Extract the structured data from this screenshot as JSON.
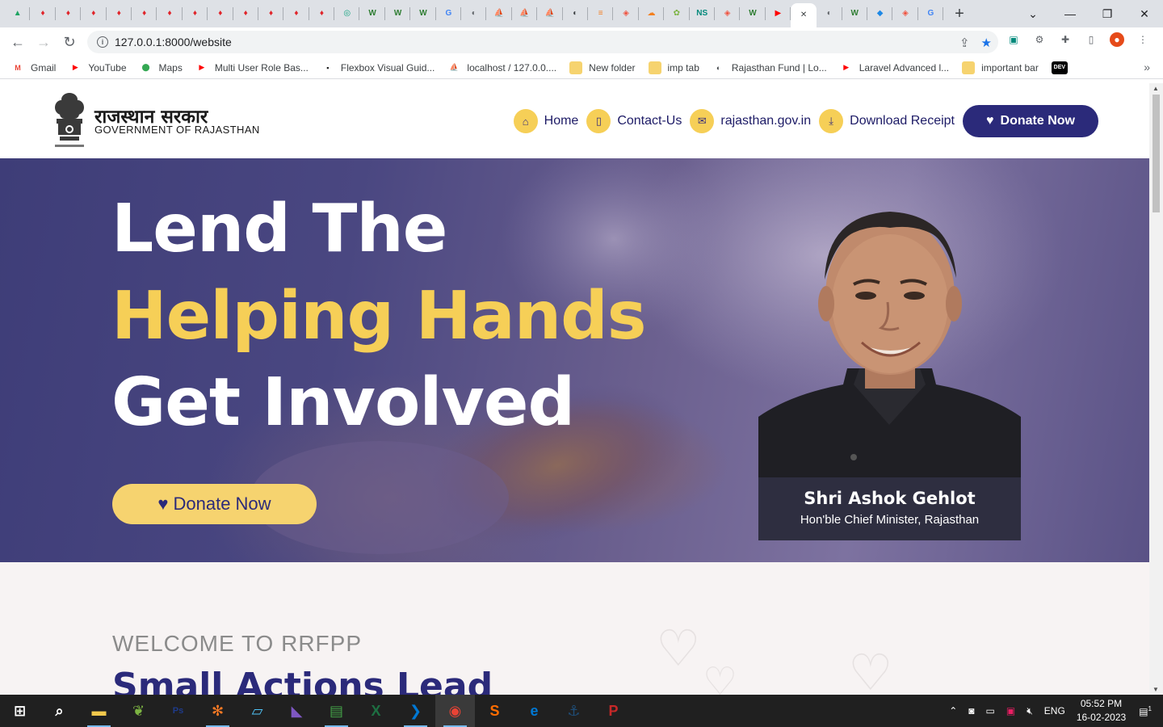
{
  "browser": {
    "tabs": [
      {
        "icon": "google-drive-icon",
        "glyph": "▲",
        "color": "#1fa463"
      },
      {
        "icon": "pin-icon",
        "glyph": "♦",
        "color": "#e0242a"
      },
      {
        "icon": "pin-icon",
        "glyph": "♦",
        "color": "#e0242a"
      },
      {
        "icon": "pin-icon",
        "glyph": "♦",
        "color": "#e0242a"
      },
      {
        "icon": "pin-icon",
        "glyph": "♦",
        "color": "#e0242a"
      },
      {
        "icon": "pin-icon",
        "glyph": "♦",
        "color": "#e0242a"
      },
      {
        "icon": "pin-icon",
        "glyph": "♦",
        "color": "#e0242a"
      },
      {
        "icon": "pin-icon",
        "glyph": "♦",
        "color": "#e0242a"
      },
      {
        "icon": "pin-icon",
        "glyph": "♦",
        "color": "#e0242a"
      },
      {
        "icon": "pin-icon",
        "glyph": "♦",
        "color": "#e0242a"
      },
      {
        "icon": "pin-icon",
        "glyph": "♦",
        "color": "#e0242a"
      },
      {
        "icon": "pin-icon",
        "glyph": "♦",
        "color": "#e0242a"
      },
      {
        "icon": "pin-icon",
        "glyph": "♦",
        "color": "#e0242a"
      },
      {
        "icon": "chatgpt-icon",
        "glyph": "◎",
        "color": "#10a37f"
      },
      {
        "icon": "w-icon",
        "glyph": "W",
        "color": "#2e7d32"
      },
      {
        "icon": "w-icon",
        "glyph": "W",
        "color": "#2e7d32"
      },
      {
        "icon": "w-icon",
        "glyph": "W",
        "color": "#2e7d32"
      },
      {
        "icon": "translate-icon",
        "glyph": "G",
        "color": "#4285f4"
      },
      {
        "icon": "globe-icon",
        "glyph": "◐",
        "color": "#5f6368"
      },
      {
        "icon": "phpmyadmin-icon",
        "glyph": "⛵",
        "color": "#e08c1a"
      },
      {
        "icon": "phpmyadmin-icon",
        "glyph": "⛵",
        "color": "#e08c1a"
      },
      {
        "icon": "phpmyadmin-icon",
        "glyph": "⛵",
        "color": "#e08c1a"
      },
      {
        "icon": "globe-icon",
        "glyph": "◐",
        "color": "#3c4043"
      },
      {
        "icon": "stackoverflow-icon",
        "glyph": "≡",
        "color": "#f48024"
      },
      {
        "icon": "laravel-icon",
        "glyph": "◈",
        "color": "#f05340"
      },
      {
        "icon": "cloud-icon",
        "glyph": "☁",
        "color": "#f38020"
      },
      {
        "icon": "app-icon",
        "glyph": "✿",
        "color": "#7cb342"
      },
      {
        "icon": "ns-icon",
        "glyph": "NS",
        "color": "#00897b"
      },
      {
        "icon": "laravel-icon",
        "glyph": "◈",
        "color": "#f05340"
      },
      {
        "icon": "w-icon",
        "glyph": "W",
        "color": "#2e7d32"
      },
      {
        "icon": "youtube-icon",
        "glyph": "▶",
        "color": "#ff0000"
      },
      {
        "icon": "close-icon",
        "glyph": "✕",
        "color": "#3c4043",
        "active": true
      },
      {
        "icon": "globe-icon",
        "glyph": "◐",
        "color": "#5f6368"
      },
      {
        "icon": "w-icon",
        "glyph": "W",
        "color": "#2e7d32"
      },
      {
        "icon": "diamond-icon",
        "glyph": "◆",
        "color": "#1e88e5"
      },
      {
        "icon": "laravel-icon",
        "glyph": "◈",
        "color": "#f05340"
      },
      {
        "icon": "google-icon",
        "glyph": "G",
        "color": "#4285f4"
      }
    ],
    "url": "127.0.0.1:8000/website",
    "bookmarks": [
      {
        "label": "Gmail",
        "icon": "gmail-icon",
        "color": "#ea4335",
        "glyph": "M"
      },
      {
        "label": "YouTube",
        "icon": "youtube-icon",
        "color": "#ff0000",
        "glyph": "▶"
      },
      {
        "label": "Maps",
        "icon": "maps-icon",
        "color": "#34a853",
        "glyph": "⬤"
      },
      {
        "label": "Multi User Role Bas...",
        "icon": "youtube-icon",
        "color": "#ff0000",
        "glyph": "▶"
      },
      {
        "label": "Flexbox Visual Guid...",
        "icon": "code-icon",
        "color": "#1b1b1b",
        "glyph": "▪"
      },
      {
        "label": "localhost / 127.0.0....",
        "icon": "phpmyadmin-icon",
        "color": "#e08c1a",
        "glyph": "⛵"
      },
      {
        "label": "New folder",
        "icon": "folder-icon",
        "color": "#f6d36f",
        "glyph": ""
      },
      {
        "label": "imp tab",
        "icon": "folder-icon",
        "color": "#f6d36f",
        "glyph": ""
      },
      {
        "label": "Rajasthan Fund | Lo...",
        "icon": "globe-icon",
        "color": "#3c4043",
        "glyph": "◐"
      },
      {
        "label": "Laravel Advanced l...",
        "icon": "youtube-icon",
        "color": "#ff0000",
        "glyph": "▶"
      },
      {
        "label": "important bar",
        "icon": "folder-icon",
        "color": "#f6d36f",
        "glyph": ""
      },
      {
        "label": "",
        "icon": "dev-icon",
        "color": "#000000",
        "glyph": "DEV"
      }
    ],
    "more": "»"
  },
  "site": {
    "brand_hindi": "राजस्थान सरकार",
    "brand_english": "GOVERNMENT OF RAJASTHAN",
    "nav": [
      {
        "label": "Home",
        "icon": "home-icon",
        "glyph": "⌂"
      },
      {
        "label": "Contact-Us",
        "icon": "phone-icon",
        "glyph": "▯"
      },
      {
        "label": "rajasthan.gov.in",
        "icon": "mail-icon",
        "glyph": "✉"
      },
      {
        "label": "Download Receipt",
        "icon": "download-icon",
        "glyph": "⤓"
      }
    ],
    "donate_nav": "Donate Now",
    "hero": {
      "line1": "Lend The",
      "line2": "Helping Hands",
      "line3": "Get Involved",
      "button": "Donate Now"
    },
    "cm": {
      "name": "Shri Ashok Gehlot",
      "title": "Hon'ble Chief Minister, Rajasthan"
    },
    "welcome": {
      "tag": "WELCOME TO RRFPP",
      "heading": "Small Actions Lead"
    }
  },
  "taskbar": {
    "apps": [
      {
        "icon": "windows-start-icon",
        "glyph": "⊞",
        "color": "#ffffff"
      },
      {
        "icon": "search-icon",
        "glyph": "⌕",
        "color": "#ffffff"
      },
      {
        "icon": "file-explorer-icon",
        "glyph": "▬",
        "color": "#f2c94c",
        "open": true
      },
      {
        "icon": "leaf-app-icon",
        "glyph": "❦",
        "color": "#7cb342"
      },
      {
        "icon": "photoshop-icon",
        "glyph": "Ps",
        "color": "#1e3a8a"
      },
      {
        "icon": "xampp-icon",
        "glyph": "✻",
        "color": "#fb7a24",
        "open": true
      },
      {
        "icon": "notepad-icon",
        "glyph": "▱",
        "color": "#4fc3f7"
      },
      {
        "icon": "visual-studio-icon",
        "glyph": "◣",
        "color": "#7e57c2"
      },
      {
        "icon": "chart-app-icon",
        "glyph": "▤",
        "color": "#43a047",
        "open": true
      },
      {
        "icon": "excel-icon",
        "glyph": "X",
        "color": "#1d6f42"
      },
      {
        "icon": "vscode-icon",
        "glyph": "❯",
        "color": "#0078d4",
        "open": true
      },
      {
        "icon": "chrome-icon",
        "glyph": "◉",
        "color": "#ea4335",
        "open": true,
        "active": true
      },
      {
        "icon": "sublime-icon",
        "glyph": "S",
        "color": "#ff6d00"
      },
      {
        "icon": "edge-icon",
        "glyph": "e",
        "color": "#0078d4"
      },
      {
        "icon": "mysql-workbench-icon",
        "glyph": "⚓",
        "color": "#1f4e79"
      },
      {
        "icon": "postman-icon",
        "glyph": "P",
        "color": "#c62828"
      }
    ],
    "tray": {
      "lang": "ENG",
      "time": "05:52 PM",
      "date": "16-02-2023",
      "notifications": "1"
    }
  }
}
